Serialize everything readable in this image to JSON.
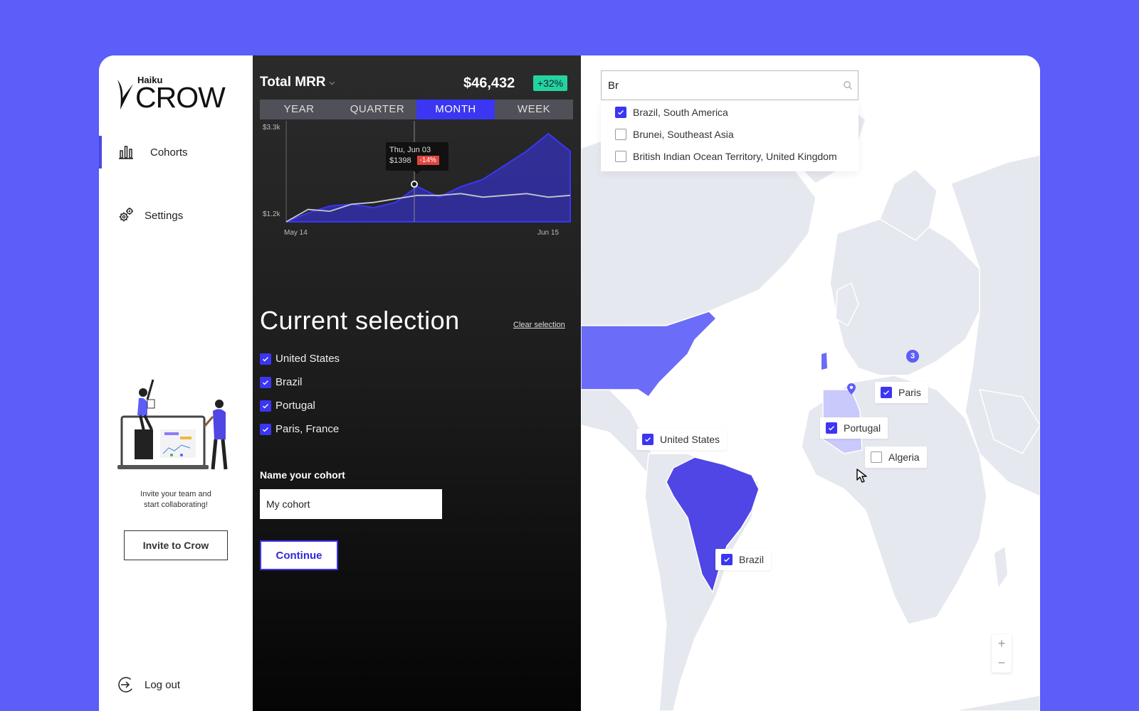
{
  "brand": {
    "super": "Haiku",
    "name": "CROW",
    "mark": "®"
  },
  "sidebar": {
    "items": [
      {
        "label": "Cohorts",
        "icon": "bar-chart-icon",
        "active": true
      },
      {
        "label": "Settings",
        "icon": "gears-icon",
        "active": false
      }
    ],
    "invite_text_1": "Invite your team and",
    "invite_text_2": "start collaborating!",
    "invite_button": "Invite to Crow",
    "logout": "Log out"
  },
  "metric": {
    "title": "Total MRR",
    "value": "$46,432",
    "change": "+32%",
    "periods": [
      "YEAR",
      "QUARTER",
      "MONTH",
      "WEEK"
    ],
    "active_period": "MONTH"
  },
  "chart_data": {
    "type": "area",
    "x_start_label": "May 14",
    "x_end_label": "Jun 15",
    "y_tick_labels": [
      "$3.3k",
      "$1.2k"
    ],
    "series": [
      {
        "values": [
          1.0,
          1.25,
          1.45,
          1.5,
          1.4,
          1.55,
          2.0,
          1.7,
          2.0,
          2.2,
          2.6,
          3.0,
          3.5,
          3.0
        ]
      },
      {
        "values": [
          1.0,
          1.35,
          1.3,
          1.5,
          1.55,
          1.65,
          1.75,
          1.75,
          1.8,
          1.7,
          1.75,
          1.8,
          1.7,
          1.75
        ]
      }
    ],
    "tooltip": {
      "date": "Thu, Jun 03",
      "value": "$1398",
      "change": "-14%"
    },
    "colors": {
      "primary": "#3b36f2",
      "secondary": "#b9b9c4"
    }
  },
  "selection": {
    "title": "Current selection",
    "clear": "Clear selection",
    "items": [
      "United States",
      "Brazil",
      "Portugal",
      "Paris, France"
    ]
  },
  "cohort": {
    "label": "Name your cohort",
    "value": "My cohort",
    "continue": "Continue"
  },
  "map": {
    "search_value": "Br",
    "results": [
      {
        "label": "Brazil, South America",
        "checked": true
      },
      {
        "label": "Brunei,  Southeast Asia",
        "checked": false
      },
      {
        "label": "British Indian Ocean Territory,  United Kingdom",
        "checked": false
      }
    ],
    "tags": [
      {
        "label": "Paris",
        "checked": true
      },
      {
        "label": "United States",
        "checked": true
      },
      {
        "label": "Portugal",
        "checked": true
      },
      {
        "label": "Algeria",
        "checked": false
      },
      {
        "label": "Brazil",
        "checked": true
      }
    ],
    "cluster_count": "3",
    "zoom_in": "+",
    "zoom_out": "−"
  },
  "colors": {
    "accent": "#3b36f2",
    "background": "#5b5ef9",
    "positive": "#24d39f",
    "negative": "#e2453f"
  }
}
